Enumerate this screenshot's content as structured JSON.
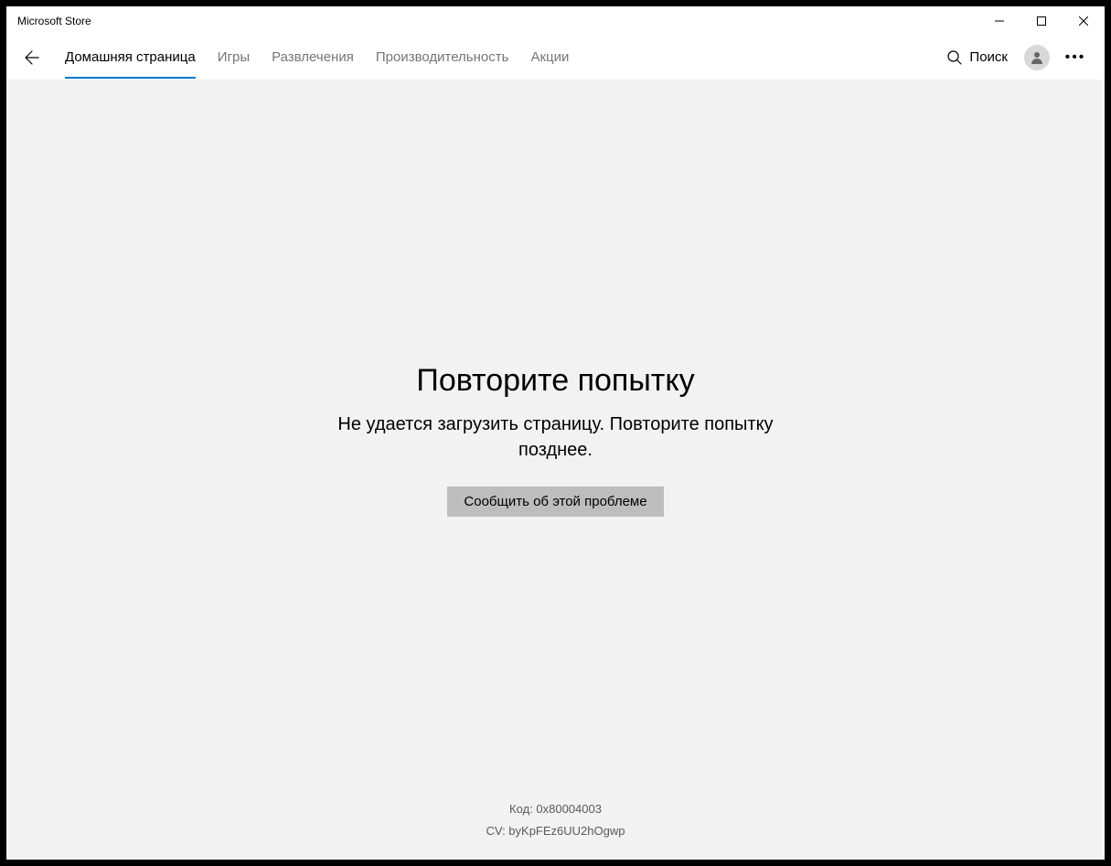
{
  "titlebar": {
    "title": "Microsoft Store"
  },
  "nav": {
    "tabs": [
      {
        "label": "Домашняя страница",
        "active": true
      },
      {
        "label": "Игры",
        "active": false
      },
      {
        "label": "Развлечения",
        "active": false
      },
      {
        "label": "Производительность",
        "active": false
      },
      {
        "label": "Акции",
        "active": false
      }
    ],
    "search_label": "Поиск"
  },
  "error": {
    "title": "Повторите попытку",
    "message": "Не удается загрузить страницу. Повторите попытку позднее.",
    "report_button": "Сообщить об этой проблеме",
    "code_line": "Код: 0x80004003",
    "cv_line": "CV: byKpFEz6UU2hOgwp"
  }
}
